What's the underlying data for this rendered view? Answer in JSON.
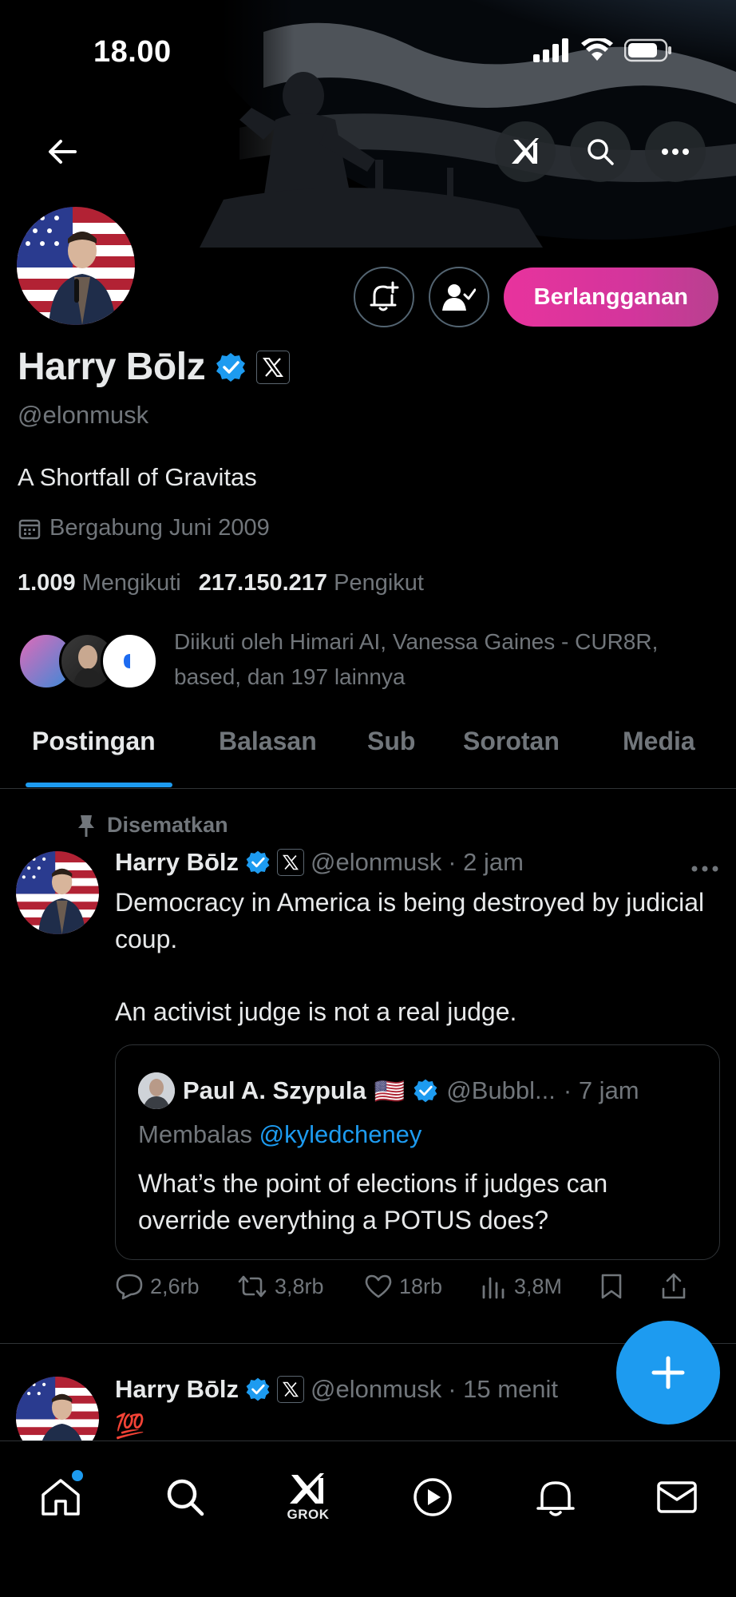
{
  "status_bar": {
    "time": "18.00"
  },
  "profile": {
    "display_name": "Harry Bōlz",
    "handle": "@elonmusk",
    "bio": "A Shortfall of Gravitas",
    "joined": "Bergabung Juni 2009",
    "following_count": "1.009",
    "following_label": "Mengikuti",
    "followers_count": "217.150.217",
    "followers_label": "Pengikut",
    "followed_by": "Diikuti oleh Himari AI, Vanessa Gaines - CUR8R, based, dan 197 lainnya",
    "subscribe_label": "Berlangganan"
  },
  "tabs": [
    {
      "label": "Postingan"
    },
    {
      "label": "Balasan"
    },
    {
      "label": "Sub"
    },
    {
      "label": "Sorotan"
    },
    {
      "label": "Media"
    }
  ],
  "tweets": [
    {
      "pinned_label": "Disematkan",
      "name": "Harry Bōlz",
      "handle": "@elonmusk",
      "time": "· 2 jam",
      "text_1": "Democracy in America is being destroyed by judicial coup.",
      "text_2": "An activist judge is not a real judge.",
      "quote": {
        "name": "Paul A. Szypula",
        "flag": "🇺🇸",
        "handle": "@Bubbl...",
        "time": "· 7 jam",
        "reply_prefix": "Membalas",
        "reply_mention": "@kyledcheney",
        "text": "What’s the point of elections if judges can override everything a POTUS does?"
      },
      "stats": {
        "replies": "2,6rb",
        "reposts": "3,8rb",
        "likes": "18rb",
        "views": "3,8M"
      }
    },
    {
      "name": "Harry Bōlz",
      "handle": "@elonmusk",
      "time": "· 15 menit",
      "text_1": "💯"
    }
  ],
  "bottom_nav": {
    "grok_label": "GROK"
  },
  "colors": {
    "accent": "#1d9bf0",
    "subscribe_gradient_start": "#e8339d",
    "subscribe_gradient_end": "#b8418f",
    "muted": "#71767b",
    "text": "#e7e9ea"
  }
}
